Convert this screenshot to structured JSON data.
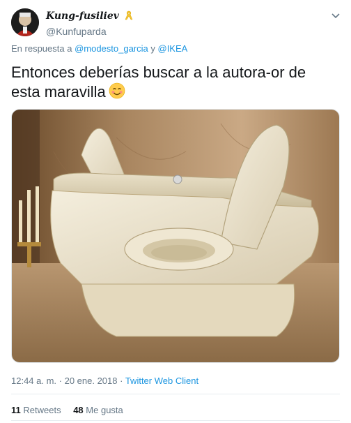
{
  "tweet": {
    "display_name": "Kung-fusiliev",
    "handle": "@Kunfuparda",
    "reply_prefix": "En respuesta a ",
    "reply_mention_1": "@modesto_garcia",
    "reply_joiner": " y ",
    "reply_mention_2": "@IKEA",
    "text": "Entonces deberías buscar a la autora-or de esta maravilla",
    "time": "12:44 a. m. · 20 ene. 2018 · ",
    "client": "Twitter Web Client",
    "retweets_count": "11",
    "retweets_label": "Retweets",
    "likes_count": "48",
    "likes_label": "Me gusta"
  },
  "icons": {
    "ribbon": "yellow-ribbon-icon",
    "chevron": "chevron-down-icon",
    "emoji": "smiling-face-emoji"
  },
  "colors": {
    "link": "#1b95e0",
    "secondary_text": "#657786",
    "ribbon": "#f4c430"
  }
}
